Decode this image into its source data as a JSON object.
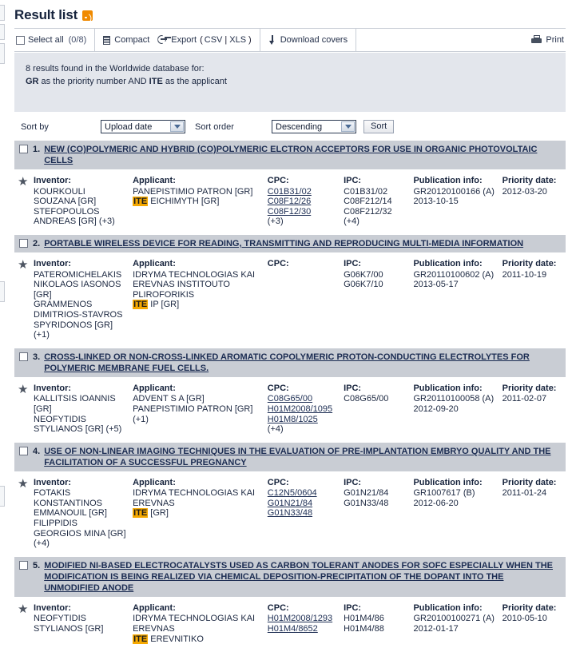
{
  "header": {
    "title": "Result list",
    "rss_icon": "rss-feed-icon"
  },
  "toolbar": {
    "select_all_label": "Select all",
    "select_all_count": "(0/8)",
    "compact_label": "Compact",
    "compact_icon": "compact-list-icon",
    "export_label": "Export",
    "export_icon": "export-icon",
    "export_formats_open": "(",
    "export_csv": "CSV",
    "export_divider": "|",
    "export_xls": "XLS",
    "export_formats_close": ")",
    "download_covers_label": "Download covers",
    "download_covers_icon": "download-arrow-icon",
    "print_label": "Print",
    "print_icon": "printer-icon"
  },
  "info": {
    "line1": "8 results found in the Worldwide database for:",
    "line2_pre": "GR",
    "line2_mid": " as the priority number AND ",
    "line2_term": "ITE",
    "line2_post": " as the applicant"
  },
  "sort": {
    "sort_by_label": "Sort by",
    "sort_by_value": "Upload date",
    "sort_order_label": "Sort order",
    "sort_order_value": "Descending",
    "sort_button_label": "Sort",
    "dropdown_icon": "chevron-down-icon"
  },
  "columns": {
    "inventor": "Inventor:",
    "applicant": "Applicant:",
    "cpc": "CPC:",
    "ipc": "IPC:",
    "publication": "Publication info:",
    "priority": "Priority date:"
  },
  "results": [
    {
      "num": "1.",
      "title": "NEW (CO)POLYMERIC AND HYBRID (CO)POLYMERIC ELCTRON ACCEPTORS FOR USE IN ORGANIC PHOTOVOLTAIC CELLS",
      "inventor": [
        "KOURKOULI SOUZANA [GR]",
        "STEFOPOULOS ANDREAS [GR] (+3)"
      ],
      "applicant": [
        {
          "text": "PANEPISTIMIO PATRON [GR]",
          "highlight": null
        },
        {
          "text": " EICHIMYTH [GR]",
          "highlight": "ITE"
        }
      ],
      "cpc": [
        "C01B31/02",
        "C08F12/26",
        "C08F12/30"
      ],
      "cpc_more": "(+3)",
      "ipc": [
        "C01B31/02",
        "C08F212/14",
        "C08F212/32"
      ],
      "ipc_more": "(+4)",
      "publication": [
        "GR20120100166 (A)",
        "2013-10-15"
      ],
      "priority": "2012-03-20"
    },
    {
      "num": "2.",
      "title": "PORTABLE WIRELESS DEVICE FOR READING, TRANSMITTING AND REPRODUCING MULTI-MEDIA INFORMATION",
      "inventor": [
        "PATEROMICHELAKIS NIKOLAOS IASONOS [GR]",
        "GRAMMENOS DIMITRIOS-STAVROS SPYRIDONOS [GR] (+1)"
      ],
      "applicant": [
        {
          "text": "IDRYMA TECHNOLOGIAS KAI EREVNAS INSTITOUTO PLIROFORIKIS ",
          "highlight": null
        },
        {
          "text": " IP [GR]",
          "highlight": "ITE"
        }
      ],
      "cpc": [],
      "cpc_more": "",
      "ipc": [
        "G06K7/00",
        "G06K7/10"
      ],
      "ipc_more": "",
      "publication": [
        "GR20110100602 (A)",
        "2013-05-17"
      ],
      "priority": "2011-10-19"
    },
    {
      "num": "3.",
      "title": "CROSS-LINKED OR NON-CROSS-LINKED AROMATIC COPOLYMERIC PROTON-CONDUCTING ELECTROLYTES FOR POLYMERIC MEMBRANE FUEL CELLS.",
      "inventor": [
        "KALLITSIS IOANNIS [GR]",
        "NEOFYTIDIS STYLIANOS [GR] (+5)"
      ],
      "applicant": [
        {
          "text": "ADVENT S A [GR]",
          "highlight": null
        },
        {
          "text": "PANEPISTIMIO PATRON [GR]",
          "highlight": null
        },
        {
          "text": "(+1)",
          "highlight": null
        }
      ],
      "cpc": [
        "C08G65/00",
        "H01M2008/1095",
        "H01M8/1025"
      ],
      "cpc_more": "(+4)",
      "ipc": [
        "C08G65/00"
      ],
      "ipc_more": "",
      "publication": [
        "GR20110100058 (A)",
        "2012-09-20"
      ],
      "priority": "2011-02-07"
    },
    {
      "num": "4.",
      "title": "USE OF NON-LINEAR IMAGING TECHNIQUES IN THE EVALUATION OF PRE-IMPLANTATION EMBRYO QUALITY AND THE FACILITATION OF A SUCCESSFUL PREGNANCY",
      "inventor": [
        "FOTAKIS KONSTANTINOS EMMANOUIL [GR]",
        "FILIPPIDIS GEORGIOS MINA [GR] (+4)"
      ],
      "applicant": [
        {
          "text": "IDRYMA TECHNOLOGIAS KAI EREVNAS ",
          "highlight": null
        },
        {
          "text": " [GR]",
          "highlight": "ITE"
        }
      ],
      "cpc": [
        "C12N5/0604",
        "G01N21/84",
        "G01N33/48"
      ],
      "cpc_more": "",
      "ipc": [
        "G01N21/84",
        "G01N33/48"
      ],
      "ipc_more": "",
      "publication": [
        "GR1007617 (B)",
        "2012-06-20"
      ],
      "priority": "2011-01-24"
    },
    {
      "num": "5.",
      "title": "MODIFIED NI-BASED ELECTROCATALYSTS USED AS CARBON TOLERANT ANODES FOR SOFC ESPECIALLY WHEN THE MODIFICATION IS BEING REALIZED VIA CHEMICAL DEPOSITION-PRECIPITATION OF THE DOPANT INTO THE UNMODIFIED ANODE",
      "inventor": [
        "NEOFYTIDIS STYLIANOS [GR]"
      ],
      "applicant": [
        {
          "text": "IDRYMA TECHNOLOGIAS KAI EREVNAS ",
          "highlight": null
        },
        {
          "text": " EREVNITIKO",
          "highlight": "ITE"
        }
      ],
      "cpc": [
        "H01M2008/1293",
        "H01M4/8652"
      ],
      "cpc_more": "",
      "ipc": [
        "H01M4/86",
        "H01M4/88"
      ],
      "ipc_more": "",
      "publication": [
        "GR20100100271 (A)",
        "2012-01-17"
      ],
      "priority": "2010-05-10"
    }
  ]
}
